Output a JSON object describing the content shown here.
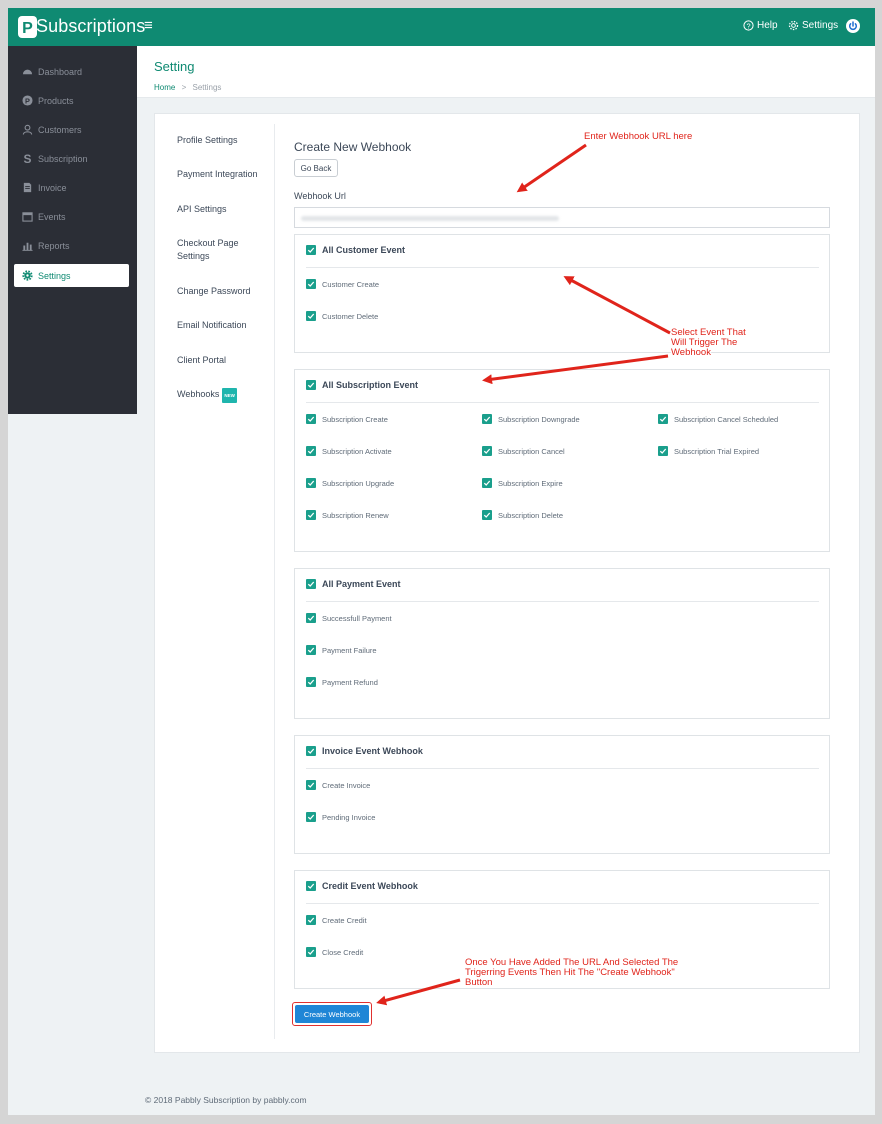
{
  "app": {
    "brand": "Subscriptions",
    "logo_letter": "P"
  },
  "topbar": {
    "help_label": "Help",
    "settings_label": "Settings",
    "menu_icon": "hamburger-icon",
    "power_icon": "power-icon"
  },
  "sidebar": {
    "items": [
      {
        "label": "Dashboard",
        "icon": "dashboard-icon"
      },
      {
        "label": "Products",
        "icon": "products-icon"
      },
      {
        "label": "Customers",
        "icon": "user-icon"
      },
      {
        "label": "Subscription",
        "icon": "subscription-icon"
      },
      {
        "label": "Invoice",
        "icon": "invoice-icon"
      },
      {
        "label": "Events",
        "icon": "calendar-icon"
      },
      {
        "label": "Reports",
        "icon": "bar-chart-icon"
      },
      {
        "label": "Settings",
        "icon": "gear-icon",
        "active": true
      }
    ]
  },
  "header": {
    "title": "Setting",
    "breadcrumb": {
      "home": "Home",
      "separator": ">",
      "current": "Settings"
    }
  },
  "settings_nav": {
    "items": [
      "Profile Settings",
      "Payment Integration",
      "API Settings",
      "Checkout Page Settings",
      "Change Password",
      "Email Notification",
      "Client Portal",
      "Webhooks"
    ],
    "new_badge": "NEW"
  },
  "webhook": {
    "title": "Create New Webhook",
    "go_back": "Go Back",
    "url_label": "Webhook Url",
    "url_value_obscured": true,
    "groups": [
      {
        "title": "All Customer Event",
        "checked": true,
        "options": [
          "Customer Create",
          "Customer Delete"
        ]
      },
      {
        "title": "All Subscription Event",
        "checked": true,
        "options": [
          "Subscription Create",
          "Subscription Downgrade",
          "Subscription Cancel Scheduled",
          "Subscription Activate",
          "Subscription Cancel",
          "Subscription Trial Expired",
          "Subscription Upgrade",
          "Subscription Expire",
          "Subscription Renew",
          "Subscription Delete"
        ]
      },
      {
        "title": "All Payment Event",
        "checked": true,
        "options": [
          "Successfull Payment",
          "Payment Failure",
          "Payment Refund"
        ]
      },
      {
        "title": "Invoice Event Webhook",
        "checked": true,
        "options": [
          "Create Invoice",
          "Pending Invoice"
        ]
      },
      {
        "title": "Credit Event Webhook",
        "checked": true,
        "options": [
          "Create Credit",
          "Close Credit"
        ]
      }
    ],
    "create_button": "Create Webhook"
  },
  "annotations": {
    "url_note": "Enter Webhook URL here",
    "event_note": [
      "Select Event That",
      "Will Trigger The",
      "Webhook"
    ],
    "button_note": [
      "Once You Have Added The URL And Selected The",
      "Trigerring Events Then Hit The \"Create Webhook\"",
      "Button"
    ]
  },
  "footer": {
    "text": "© 2018 Pabbly Subscription by pabbly.com"
  },
  "colors": {
    "primary": "#0f8a72",
    "checkbox": "#1a9f8c",
    "button": "#1f86d6",
    "annotation": "#e0241b",
    "sidebar": "#2b2e36"
  }
}
